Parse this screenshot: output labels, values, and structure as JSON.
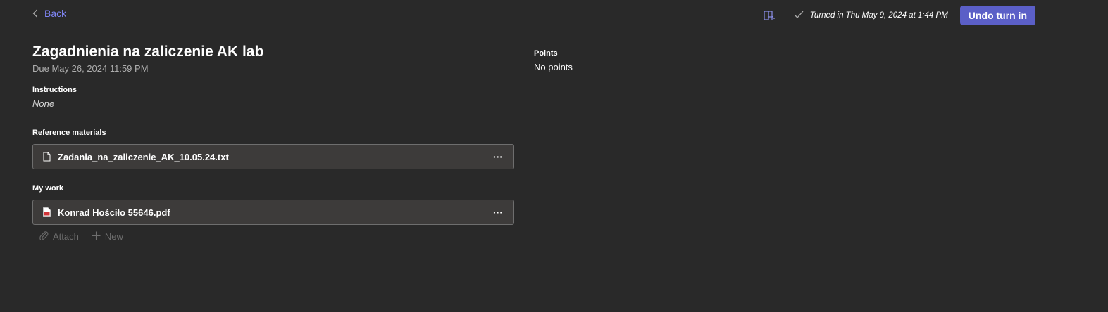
{
  "nav": {
    "back_label": "Back"
  },
  "status": {
    "turned_in_text": "Turned in Thu May 9, 2024 at 1:44 PM"
  },
  "actions_top": {
    "undo_label": "Undo turn in"
  },
  "assignment": {
    "title": "Zagadnienia na zaliczenie AK lab",
    "due": "Due May 26, 2024 11:59 PM",
    "instructions_label": "Instructions",
    "instructions_value": "None",
    "reference_label": "Reference materials",
    "reference_files": [
      {
        "name": "Zadania_na_zaliczenie_AK_10.05.24.txt",
        "icon": "text-file-icon"
      }
    ],
    "my_work_label": "My work",
    "my_work_files": [
      {
        "name": "Konrad Hościło 55646.pdf",
        "icon": "pdf-file-icon"
      }
    ],
    "attach_label": "Attach",
    "new_label": "New"
  },
  "points": {
    "label": "Points",
    "value": "No points"
  },
  "colors": {
    "accent": "#5b5fc7",
    "link": "#7f85f5",
    "background": "#292929",
    "card": "#3d3b3a"
  },
  "icons": [
    "chevron-left-icon",
    "immersive-reader-icon",
    "checkmark-icon",
    "text-file-icon",
    "pdf-file-icon",
    "more-icon",
    "paperclip-icon",
    "plus-icon"
  ]
}
